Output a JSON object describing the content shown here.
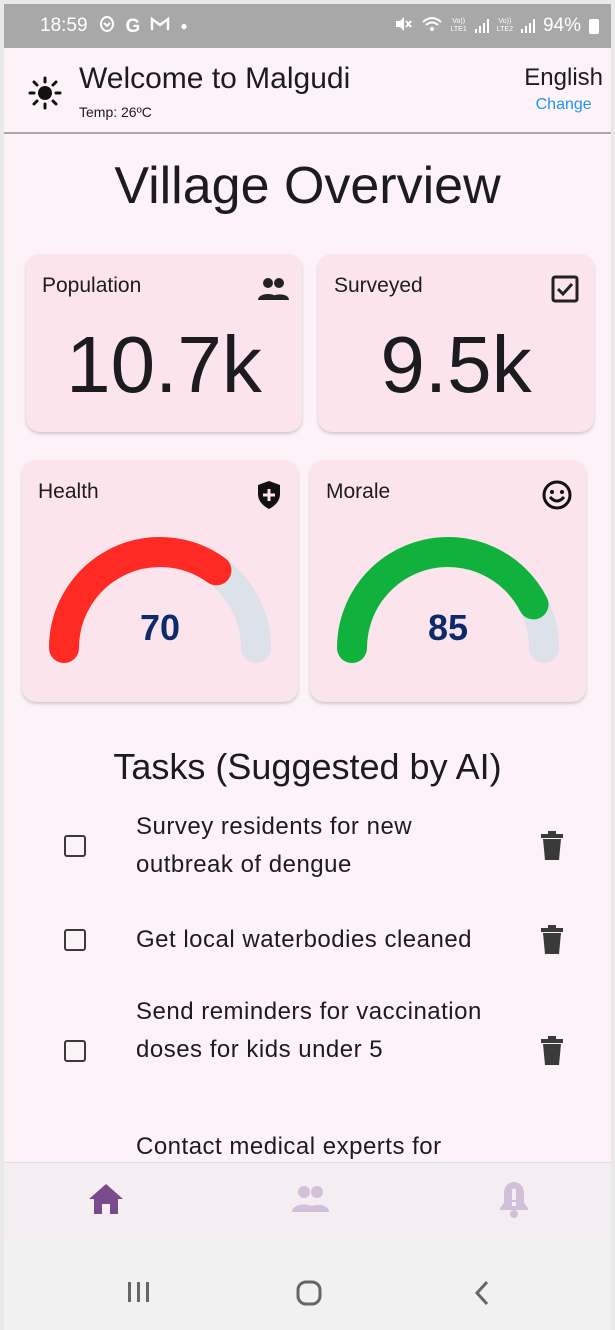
{
  "status_bar": {
    "time": "18:59",
    "app_icons": [
      "notification-icon",
      "google-icon",
      "gmail-icon",
      "dot-icon"
    ],
    "sim1_label_top": "Vo))",
    "sim1_label_bottom": "LTE1",
    "sim2_label_top": "Vo))",
    "sim2_label_bottom": "LTE2",
    "battery": "94%"
  },
  "header": {
    "title": "Welcome to Malgudi",
    "temp": "Temp: 26ºC",
    "language": "English",
    "change_label": "Change",
    "link_color": "#2196f3"
  },
  "overview": {
    "title": "Village Overview",
    "cards": [
      {
        "label": "Population",
        "value": "10.7k",
        "icon": "people-icon"
      },
      {
        "label": "Surveyed",
        "value": "9.5k",
        "icon": "checkbox-checked-icon"
      }
    ],
    "gauges": [
      {
        "label": "Health",
        "value": 70,
        "max": 100,
        "color": "#ff2a23",
        "icon": "shield-plus-icon"
      },
      {
        "label": "Morale",
        "value": 85,
        "max": 100,
        "color": "#10b13c",
        "icon": "smiley-icon"
      }
    ],
    "gauge_track_color": "#dde1ea",
    "gauge_value_color": "#0d2b6b"
  },
  "tasks": {
    "title": "Tasks (Suggested by AI)",
    "items": [
      {
        "text": "Survey residents for new outbreak of dengue",
        "checked": false
      },
      {
        "text": "Get local waterbodies cleaned",
        "checked": false
      },
      {
        "text": "Send reminders for vaccination doses for kids under 5",
        "checked": false
      },
      {
        "text": "Contact medical experts for",
        "checked": false
      }
    ]
  },
  "bottom_nav": {
    "items": [
      {
        "name": "home",
        "icon": "home-icon",
        "active": true
      },
      {
        "name": "people",
        "icon": "people-icon",
        "active": false
      },
      {
        "name": "alerts",
        "icon": "bell-alert-icon",
        "active": false
      }
    ],
    "active_color": "#7b4a8c",
    "inactive_color": "#d2bfd8"
  }
}
